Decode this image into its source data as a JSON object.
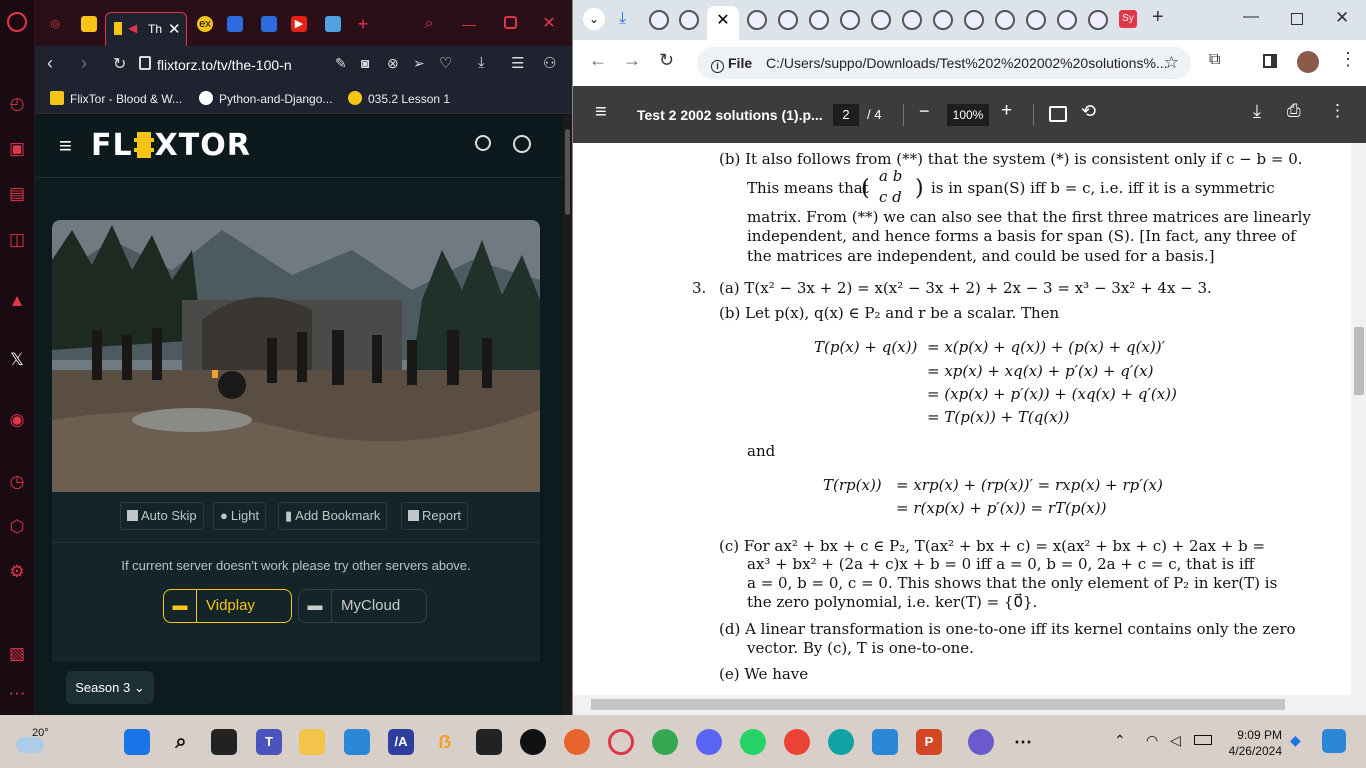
{
  "opera": {
    "tab_title": "Th",
    "url": "flixtorz.to/tv/the-100-n",
    "bookmarks": [
      {
        "label": "FlixTor - Blood & W..."
      },
      {
        "label": "Python-and-Django..."
      },
      {
        "label": "035.2 Lesson 1"
      }
    ],
    "site": {
      "logo": "FL XTOR",
      "controls": {
        "auto_skip": "Auto Skip",
        "light": "Light",
        "bookmark": "Add Bookmark",
        "report": "Report"
      },
      "server_hint": "If current server doesn't work please try other servers above.",
      "servers": [
        "Vidplay",
        "MyCloud"
      ],
      "season": "Season 3"
    }
  },
  "chrome": {
    "omnibox_label": "File",
    "url": "C:/Users/suppo/Downloads/Test%202%202002%20solutions%...",
    "pdf": {
      "title": "Test 2 2002 solutions (1).p...",
      "page": "2",
      "page_total": "/ 4",
      "zoom": "100%"
    },
    "doc": {
      "b_line1": "(b)  It also follows from (**) that the system (*) is consistent only if c − b = 0.",
      "b_line2a": "This means that",
      "matrix_r1": "a   b",
      "matrix_r2": "c   d",
      "b_line2b": "is in span(S) iff b = c, i.e. iff it is a symmetric",
      "b_line3": "matrix. From (**) we can also see that the first three matrices are linearly",
      "b_line4": "independent, and hence forms a basis for span (S). [In fact, any three of",
      "b_line5": "the matrices are independent, and could be used for a basis.]",
      "q3_num": "3.",
      "q3a": "(a)  T(x² − 3x + 2) = x(x² − 3x + 2) + 2x − 3 = x³ − 3x² + 4x − 3.",
      "q3b": "(b)  Let p(x), q(x) ∈ P₂ and r be a scalar. Then",
      "eq1_lhs": "T(p(x) + q(x))",
      "eq1_r1": "=   x(p(x) + q(x)) + (p(x) + q(x))′",
      "eq1_r2": "=   xp(x) + xq(x) + p′(x) + q′(x)",
      "eq1_r3": "=   (xp(x) + p′(x)) + (xq(x) + q′(x))",
      "eq1_r4": "=   T(p(x)) + T(q(x))",
      "and": "and",
      "eq2_lhs": "T(rp(x))",
      "eq2_r1": "=   xrp(x) + (rp(x))′ = rxp(x) + rp′(x)",
      "eq2_r2": "=   r(xp(x) + p′(x)) = rT(p(x))",
      "c_l1": "(c)  For ax² + bx + c ∈ P₂, T(ax² + bx + c) = x(ax² + bx + c) + 2ax + b =",
      "c_l2": "ax³ + bx² + (2a + c)x + b = 0 iff a = 0, b = 0, 2a + c = c, that is iff",
      "c_l3": "a = 0, b = 0, c = 0. This shows that the only element of P₂ in ker(T) is",
      "c_l4": "the zero polynomial, i.e. ker(T) = {0⃗}.",
      "d_l1": "(d)  A linear transformation is one-to-one iff its kernel contains only the zero",
      "d_l2": "vector. By (c), T is one-to-one.",
      "e_l1": "(e)  We have"
    }
  },
  "taskbar": {
    "weather_temp": "20°",
    "time": "9:09 PM",
    "date": "4/26/2024"
  },
  "colors": {
    "opera_red": "#e0364a",
    "flixtor_yellow": "#f5c518",
    "pdf_toolbar": "#3c3c3c"
  }
}
